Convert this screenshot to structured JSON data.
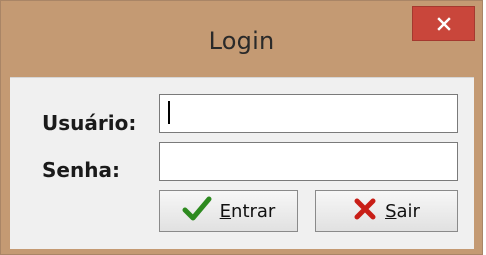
{
  "window": {
    "title": "Login",
    "close_icon": "close-icon",
    "colors": {
      "frame": "#c49a73",
      "close": "#c9463b",
      "client": "#f0f0f0"
    }
  },
  "form": {
    "user_label": "Usuário:",
    "user_value": "",
    "pass_label": "Senha:",
    "pass_value": ""
  },
  "buttons": {
    "ok": {
      "accel": "E",
      "rest": "ntrar",
      "icon": "checkmark-icon"
    },
    "cancel": {
      "accel": "S",
      "rest": "air",
      "icon": "x-mark-icon"
    }
  }
}
